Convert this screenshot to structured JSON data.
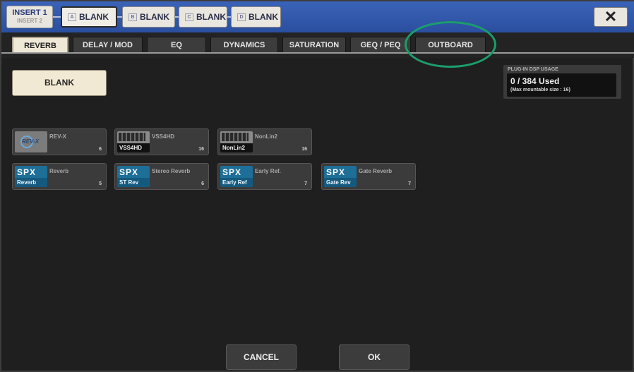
{
  "insert_bar": {
    "insert_label": "INSERT 1",
    "insert_sublabel": "INSERT 2",
    "slots": [
      {
        "badge": "A",
        "label": "BLANK"
      },
      {
        "badge": "B",
        "label": "BLANK"
      },
      {
        "badge": "C",
        "label": "BLANK"
      },
      {
        "badge": "D",
        "label": "BLANK"
      }
    ],
    "close_glyph": "✕"
  },
  "tabs": [
    {
      "label": "REVERB",
      "active": true
    },
    {
      "label": "DELAY / MOD"
    },
    {
      "label": "EQ"
    },
    {
      "label": "DYNAMICS"
    },
    {
      "label": "SATURATION"
    },
    {
      "label": "GEQ / PEQ"
    },
    {
      "label": "OUTBOARD"
    }
  ],
  "blank_button": "BLANK",
  "dsp_usage": {
    "title": "PLUG-IN DSP USAGE",
    "used": "0 / 384 Used",
    "max": "(Max mountable size : 16)"
  },
  "plugins": [
    {
      "name": "REV-X",
      "thumb_label": "REV-X",
      "count": "6",
      "style": "revx"
    },
    {
      "name": "VSS4HD",
      "thumb_label": "VSS4HD",
      "count": "16",
      "style": "dark"
    },
    {
      "name": "NonLin2",
      "thumb_label": "NonLin2",
      "count": "16",
      "style": "dark"
    },
    {
      "name": "Reverb",
      "logo": "SPX",
      "thumb_label": "Reverb",
      "count": "5",
      "style": "spx"
    },
    {
      "name": "Stereo Reverb",
      "logo": "SPX",
      "thumb_label": "ST Rev",
      "count": "6",
      "style": "spx"
    },
    {
      "name": "Early Ref.",
      "logo": "SPX",
      "thumb_label": "Early Ref",
      "count": "7",
      "style": "spx"
    },
    {
      "name": "Gate Reverb",
      "logo": "SPX",
      "thumb_label": "Gate Rev",
      "count": "7",
      "style": "spx"
    }
  ],
  "footer": {
    "cancel": "CANCEL",
    "ok": "OK"
  },
  "colors": {
    "topbar": "#2f56a8",
    "highlight_circle": "#1c9d6b",
    "active_tab": "#efe8d6"
  }
}
